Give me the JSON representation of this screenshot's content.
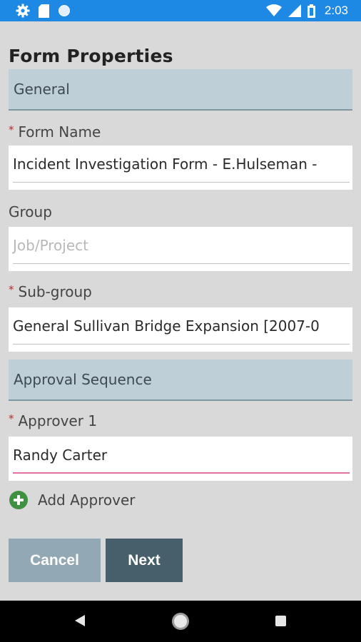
{
  "status_bar": {
    "time": "2:03",
    "left_icons": [
      "gear-icon",
      "sd-card-icon",
      "circle-icon"
    ],
    "right_icons": [
      "wifi-icon",
      "signal-icon",
      "battery-icon"
    ],
    "color": "#1e88e5"
  },
  "page": {
    "title": "Form Properties"
  },
  "sections": {
    "general": "General",
    "approval": "Approval Sequence"
  },
  "fields": {
    "form_name": {
      "label": "Form Name",
      "required_mark": "*",
      "value": "Incident Investigation Form - E.Hulseman -"
    },
    "group": {
      "label": "Group",
      "placeholder": "Job/Project"
    },
    "sub_group": {
      "label": "Sub-group",
      "required_mark": "*",
      "value": "General Sullivan Bridge Expansion [2007-0"
    },
    "approver_1": {
      "label": "Approver 1",
      "required_mark": "*",
      "value": "Randy Carter"
    }
  },
  "add_approver": {
    "label": "Add Approver",
    "icon": "plus-circle-icon",
    "color": "#3d9140"
  },
  "buttons": {
    "cancel": "Cancel",
    "next": "Next"
  },
  "colors": {
    "section_header_bg": "#bfcfd8",
    "cancel_bg": "#93a8b5",
    "next_bg": "#475e6b",
    "required": "#c62828",
    "active_underline": "#e0709f"
  }
}
